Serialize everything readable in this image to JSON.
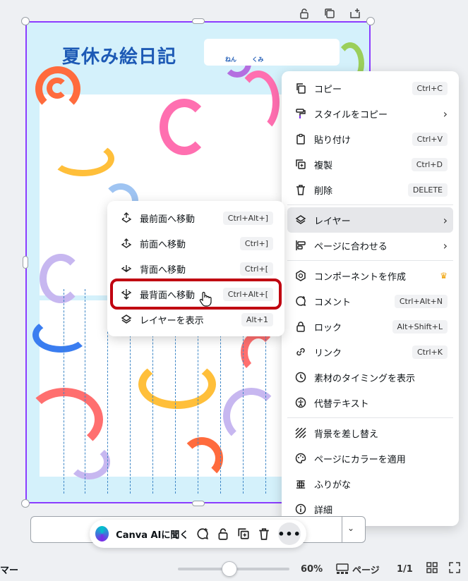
{
  "canvas": {
    "title": "夏休み絵日記",
    "name_label_1": "ねん",
    "name_label_2": "くみ"
  },
  "context_menu": {
    "items": [
      {
        "label": "コピー",
        "shortcut": "Ctrl+C",
        "icon": "copy-icon"
      },
      {
        "label": "スタイルをコピー",
        "icon": "paint-roller-icon",
        "has_submenu": true
      },
      {
        "label": "貼り付け",
        "shortcut": "Ctrl+V",
        "icon": "clipboard-icon"
      },
      {
        "label": "複製",
        "shortcut": "Ctrl+D",
        "icon": "duplicate-icon"
      },
      {
        "label": "削除",
        "shortcut": "DELETE",
        "icon": "trash-icon"
      },
      {
        "label": "レイヤー",
        "icon": "layers-icon",
        "has_submenu": true,
        "active": true
      },
      {
        "label": "ページに合わせる",
        "icon": "align-icon",
        "has_submenu": true
      },
      {
        "label": "コンポーネントを作成",
        "icon": "component-icon",
        "premium": true
      },
      {
        "label": "コメント",
        "shortcut": "Ctrl+Alt+N",
        "icon": "comment-icon"
      },
      {
        "label": "ロック",
        "shortcut": "Alt+Shift+L",
        "icon": "lock-icon"
      },
      {
        "label": "リンク",
        "shortcut": "Ctrl+K",
        "icon": "link-icon"
      },
      {
        "label": "素材のタイミングを表示",
        "icon": "clock-icon"
      },
      {
        "label": "代替テキスト",
        "icon": "accessibility-icon"
      },
      {
        "label": "背景を差し替え",
        "icon": "hatch-icon"
      },
      {
        "label": "ページにカラーを適用",
        "icon": "palette-icon"
      },
      {
        "label": "ふりがな",
        "icon": "furigana-icon"
      },
      {
        "label": "詳細",
        "icon": "info-icon"
      }
    ]
  },
  "layer_submenu": {
    "items": [
      {
        "label": "最前面へ移動",
        "shortcut": "Ctrl+Alt+]"
      },
      {
        "label": "前面へ移動",
        "shortcut": "Ctrl+]"
      },
      {
        "label": "背面へ移動",
        "shortcut": "Ctrl+["
      },
      {
        "label": "最背面へ移動",
        "shortcut": "Ctrl+Alt+["
      },
      {
        "label": "レイヤーを表示",
        "shortcut": "Alt+1"
      }
    ]
  },
  "ai_toolbar": {
    "label": "Canva AIに聞く",
    "more": "•••"
  },
  "footer": {
    "notes_label": "マー",
    "zoom": "60%",
    "pages_label": "ページ",
    "page_count": "1/1",
    "zoom_fraction": 0.6
  },
  "colors": {
    "accent": "#8b3dff",
    "highlight": "#c00010",
    "title": "#1d5ab5"
  }
}
